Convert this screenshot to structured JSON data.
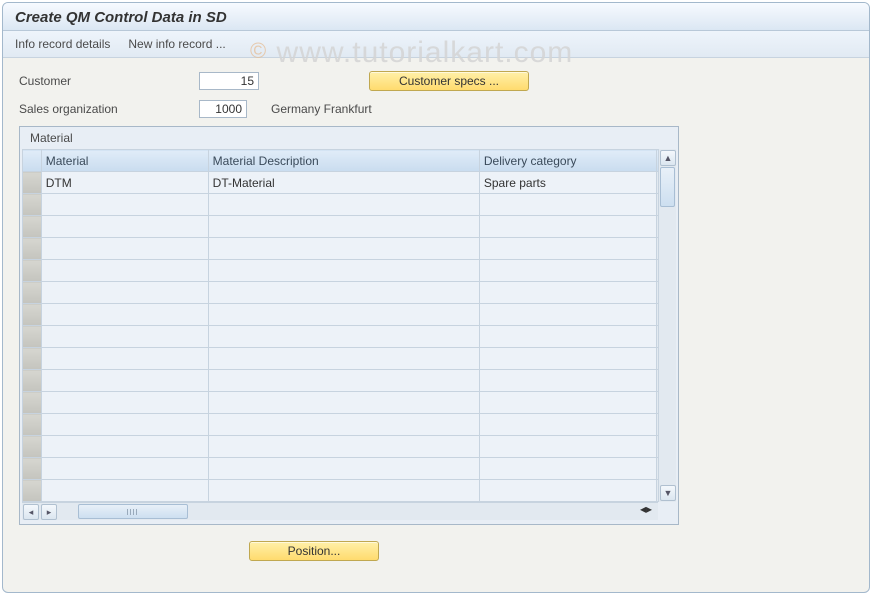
{
  "title": "Create QM Control Data in SD",
  "toolbar": {
    "info_record_details": "Info record details",
    "new_info_record": "New info record ..."
  },
  "form": {
    "customer_label": "Customer",
    "customer_value": "15",
    "sales_org_label": "Sales organization",
    "sales_org_value": "1000",
    "sales_org_text": "Germany Frankfurt"
  },
  "buttons": {
    "customer_specs": "Customer specs ...",
    "position": "Position..."
  },
  "table": {
    "group_title": "Material",
    "columns": {
      "material": "Material",
      "description": "Material Description",
      "delivery_category": "Delivery category"
    },
    "rows": [
      {
        "material": "DTM",
        "description": "DT-Material",
        "delivery_category": "Spare parts"
      }
    ]
  },
  "watermark": {
    "copy": "©",
    "text": " www.tutorialkart.com"
  }
}
